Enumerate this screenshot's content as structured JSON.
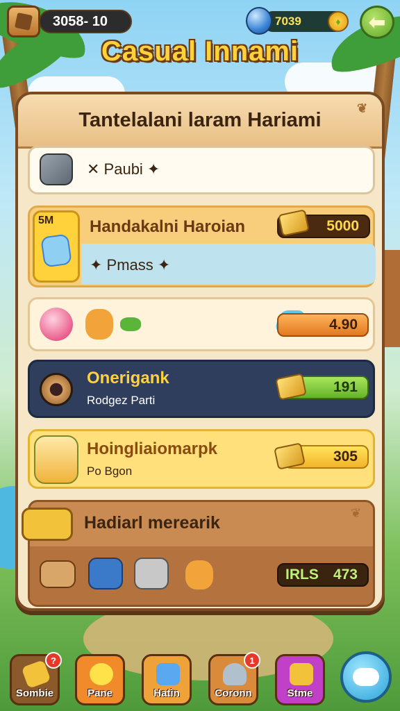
{
  "hud": {
    "coins": "3058- 10",
    "gems": "7039",
    "menu_icon": "journal-icon",
    "back_icon": "arrow-left-icon",
    "back_glyph": "⬅"
  },
  "game_title": "Casual Innami",
  "panel": {
    "title": "Tantelalani laram Hariami",
    "rows": [
      {
        "id": "row1",
        "icon": "camera-globe-icon",
        "text": "✕ Paubi ✦"
      },
      {
        "id": "row2",
        "badge": "5M",
        "title": "Handakalni Haroian",
        "value": "5000",
        "sub": "✦ Pmass ✦",
        "icon": "gift-box-icon"
      },
      {
        "id": "row3",
        "value": "4.90",
        "icons": [
          "pink-orb-icon",
          "nugget-icon",
          "leaf-icon",
          "crystal-icon"
        ]
      },
      {
        "id": "row4",
        "title": "Onerigank",
        "sub": "Rodgez Parti",
        "value": "191",
        "icon": "camera-lens-icon"
      },
      {
        "id": "row5",
        "title": "Hoingliaiomarpk",
        "sub": "Po Bgon",
        "value": "305",
        "icon": "character-icon"
      },
      {
        "id": "row6",
        "title": "Hadiarl merearik",
        "value_prefix": "IRLS",
        "value": "473",
        "icons": [
          "scroll-icon",
          "gem-box-icon",
          "chest-icon",
          "nugget-icon"
        ]
      }
    ]
  },
  "nav": [
    {
      "label": "Sombie",
      "badge": "?",
      "color": "#7a4a22"
    },
    {
      "label": "Pane",
      "badge": "",
      "color": "#f08a2a"
    },
    {
      "label": "Hatin",
      "badge": "",
      "color": "#f0a23a"
    },
    {
      "label": "Coronn",
      "badge": "1",
      "color": "#d98a3a"
    },
    {
      "label": "Stme",
      "badge": "",
      "color": "#c040c8"
    }
  ],
  "colors": {
    "panel_bg": "#f6e7c9",
    "title_gold": "#ffd23c",
    "row_dark": "#2e3e5c",
    "row_yellow": "#ffe07a"
  }
}
